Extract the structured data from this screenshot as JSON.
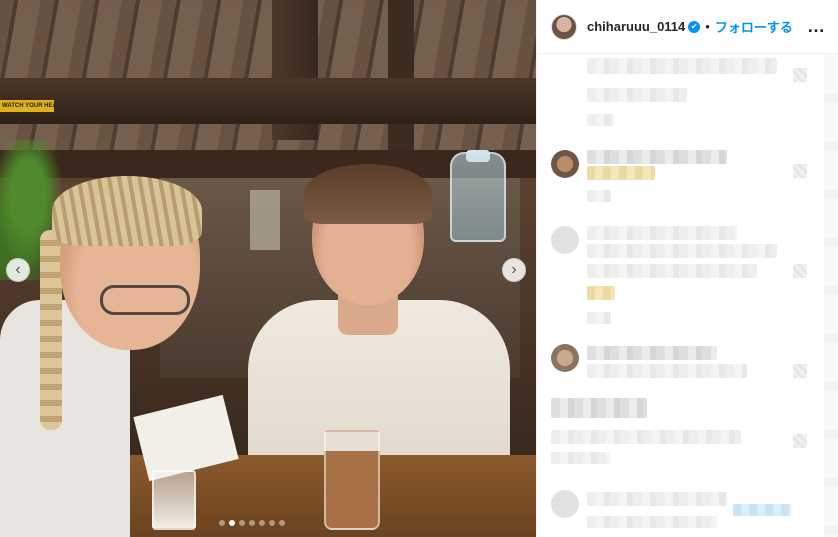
{
  "post": {
    "image": {
      "sign_text": "WATCH YOUR HEAD",
      "carousel": {
        "total": 7,
        "active_index": 1
      }
    },
    "nav": {
      "prev_glyph": "‹",
      "next_glyph": "›"
    }
  },
  "header": {
    "username": "chiharuuu_0114",
    "verified_glyph": "✔",
    "separator": "•",
    "follow_label": "フォローする",
    "more_glyph": "…"
  },
  "colors": {
    "accent": "#0095f6",
    "text": "#262626",
    "border": "#efefef"
  },
  "comments_note": ""
}
